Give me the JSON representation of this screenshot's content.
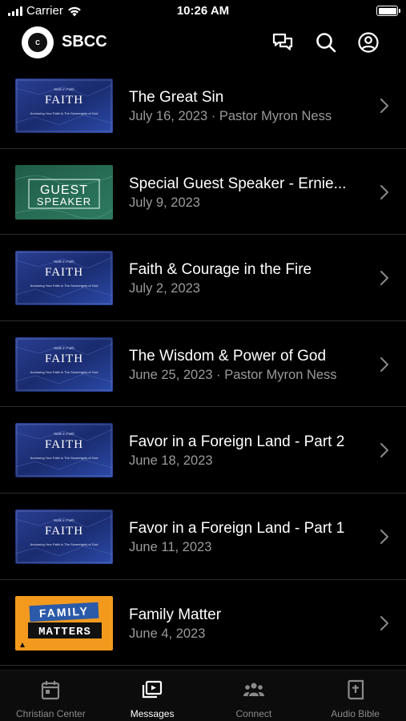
{
  "status": {
    "carrier": "Carrier",
    "time": "10:26 AM",
    "battery_level": 1.0
  },
  "header": {
    "logo_text": "C",
    "title": "SBCC",
    "icons": [
      "chat-icon",
      "search-icon",
      "profile-icon"
    ]
  },
  "messages": [
    {
      "title": "The Great Sin",
      "subtitle": "July 16, 2023 · Pastor Myron Ness",
      "thumbnail": "faith"
    },
    {
      "title": "Special Guest Speaker - Ernie...",
      "subtitle": "July 9, 2023",
      "thumbnail": "guest"
    },
    {
      "title": "Faith & Courage in the Fire",
      "subtitle": "July 2, 2023",
      "thumbnail": "faith"
    },
    {
      "title": "The Wisdom & Power of God",
      "subtitle": "June 25, 2023 · Pastor Myron Ness",
      "thumbnail": "faith"
    },
    {
      "title": "Favor in a Foreign Land - Part 2",
      "subtitle": "June 18, 2023",
      "thumbnail": "faith"
    },
    {
      "title": "Favor in a Foreign Land - Part 1",
      "subtitle": "June 11, 2023",
      "thumbnail": "faith"
    },
    {
      "title": "Family Matter",
      "subtitle": "June 4, 2023",
      "thumbnail": "family"
    }
  ],
  "thumbnails": {
    "faith": {
      "kicker": "Walk in Faith",
      "word": "FAITH",
      "tagline": "Anchoring Your Faith in The Sovereignty of God"
    },
    "guest": {
      "line1": "GUEST",
      "line2": "SPEAKER"
    },
    "family": {
      "line1": "FAMILY",
      "line2": "MATTERS"
    }
  },
  "tabs": [
    {
      "label": "Christian Center",
      "icon": "calendar-icon",
      "active": false
    },
    {
      "label": "Messages",
      "icon": "video-library-icon",
      "active": true
    },
    {
      "label": "Connect",
      "icon": "people-icon",
      "active": false
    },
    {
      "label": "Audio Bible",
      "icon": "bible-icon",
      "active": false
    }
  ],
  "colors": {
    "background": "#000000",
    "subtitle": "#9a9a9a",
    "tab_inactive": "#8a8a8a",
    "faith_blue": "#1d2f78",
    "guest_green": "#2d6b55",
    "family_orange": "#f39a1e"
  }
}
